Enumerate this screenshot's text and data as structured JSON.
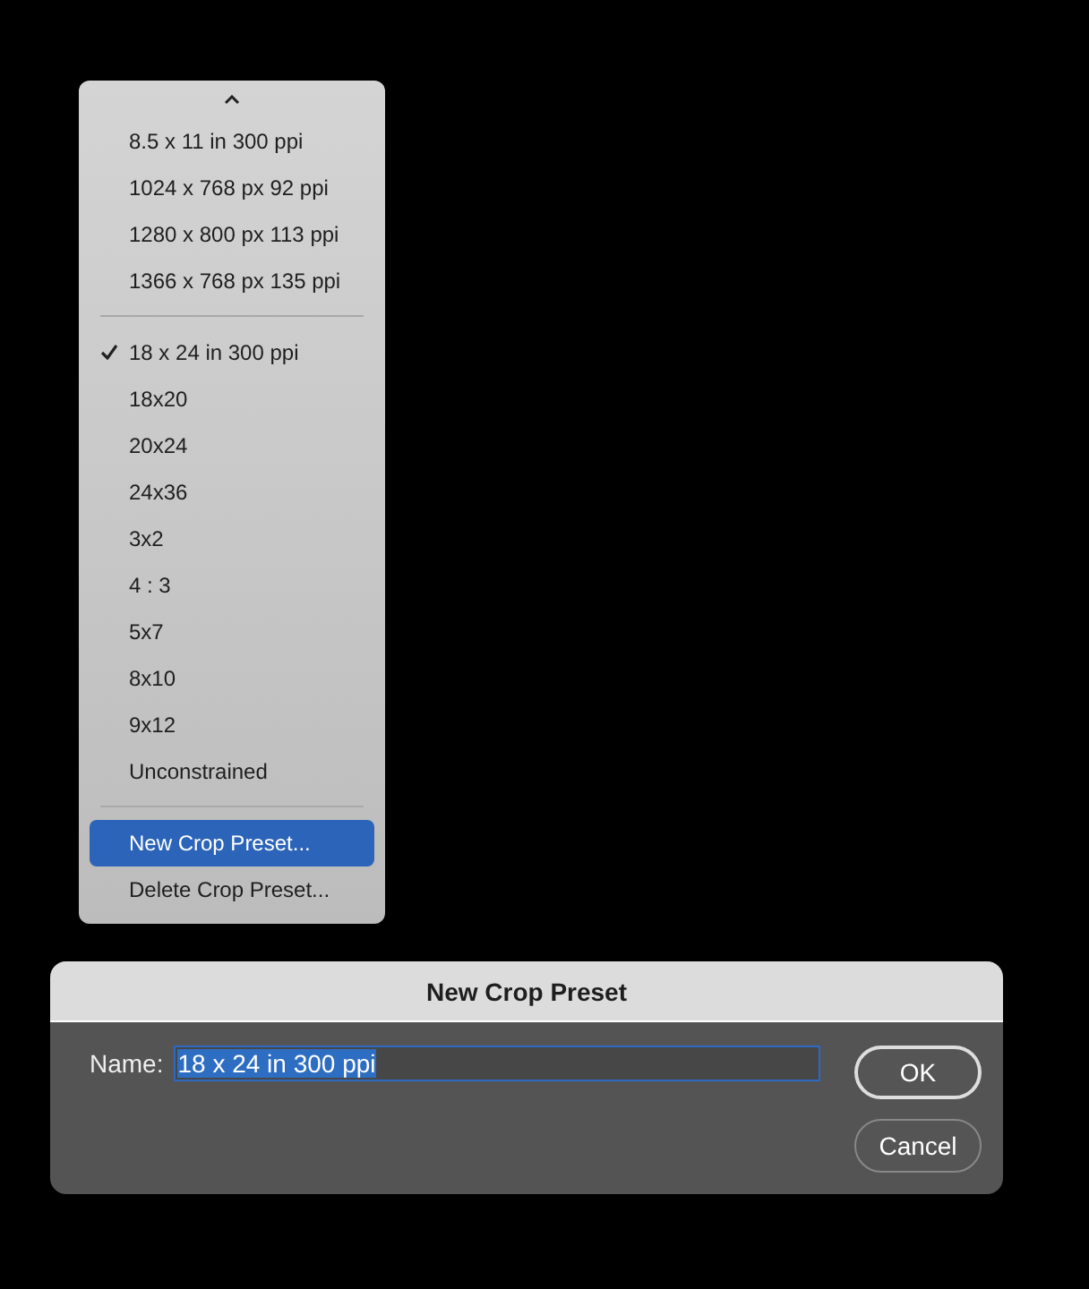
{
  "menu": {
    "groups": [
      {
        "items": [
          {
            "label": "8.5 x 11 in 300 ppi",
            "checked": false,
            "selected": false
          },
          {
            "label": "1024 x 768 px 92 ppi",
            "checked": false,
            "selected": false
          },
          {
            "label": "1280 x 800 px 113 ppi",
            "checked": false,
            "selected": false
          },
          {
            "label": "1366 x 768 px 135 ppi",
            "checked": false,
            "selected": false
          }
        ]
      },
      {
        "items": [
          {
            "label": "18 x 24 in 300 ppi",
            "checked": true,
            "selected": false
          },
          {
            "label": "18x20",
            "checked": false,
            "selected": false
          },
          {
            "label": "20x24",
            "checked": false,
            "selected": false
          },
          {
            "label": "24x36",
            "checked": false,
            "selected": false
          },
          {
            "label": "3x2",
            "checked": false,
            "selected": false
          },
          {
            "label": "4 : 3",
            "checked": false,
            "selected": false
          },
          {
            "label": "5x7",
            "checked": false,
            "selected": false
          },
          {
            "label": "8x10",
            "checked": false,
            "selected": false
          },
          {
            "label": "9x12",
            "checked": false,
            "selected": false
          },
          {
            "label": "Unconstrained",
            "checked": false,
            "selected": false
          }
        ]
      },
      {
        "items": [
          {
            "label": "New Crop Preset...",
            "checked": false,
            "selected": true
          },
          {
            "label": "Delete Crop Preset...",
            "checked": false,
            "selected": false
          }
        ]
      }
    ]
  },
  "dialog": {
    "title": "New Crop Preset",
    "name_label": "Name:",
    "name_value": "18 x 24 in 300 ppi",
    "text_selected": true,
    "buttons": [
      "OK",
      "Cancel"
    ]
  }
}
